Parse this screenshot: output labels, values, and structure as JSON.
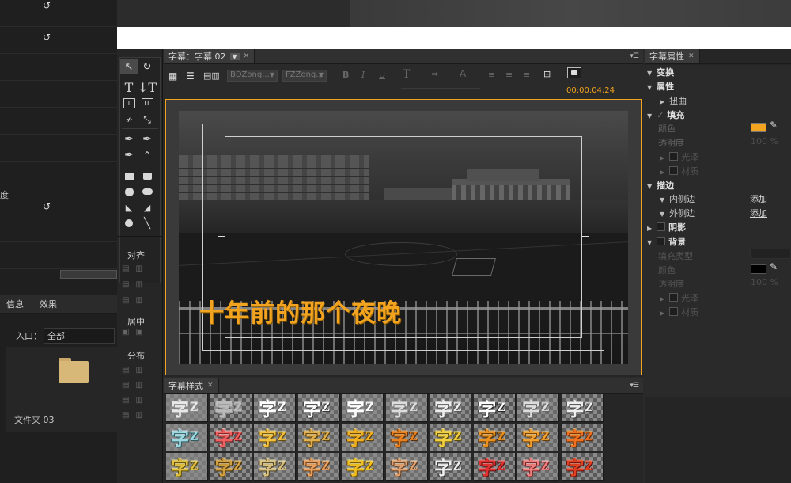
{
  "title_tab": "字幕：字幕 02",
  "props_tab": "字幕属性",
  "styles_tab": "字幕样式",
  "font_family": "BDZong...",
  "font_style": "FZZong...",
  "timecode": "00:00:04:24",
  "caption_text": "十年前的那个夜晚",
  "left": {
    "row_label": "度",
    "tab_info": "信息",
    "tab_effects": "效果",
    "entry_label": "入口：",
    "entry_value": "全部",
    "folder_label": "文件夹 03"
  },
  "tools": {
    "align": "对齐",
    "center": "居中",
    "distribute": "分布"
  },
  "properties": {
    "transform": "变换",
    "attributes": "属性",
    "distort": "扭曲",
    "fill": "填充",
    "color": "颜色",
    "opacity": "透明度",
    "opacity_value": "100 %",
    "sheen": "光泽",
    "texture": "材质",
    "stroke": "描边",
    "inner_stroke": "内侧边",
    "outer_stroke": "外侧边",
    "add": "添加",
    "shadow": "阴影",
    "background": "背景",
    "fill_type": "填充类型",
    "fill_color": "#f2a31f",
    "bg_color": "#000000"
  },
  "styles": {
    "glyph": "字",
    "suffix": "Z"
  }
}
